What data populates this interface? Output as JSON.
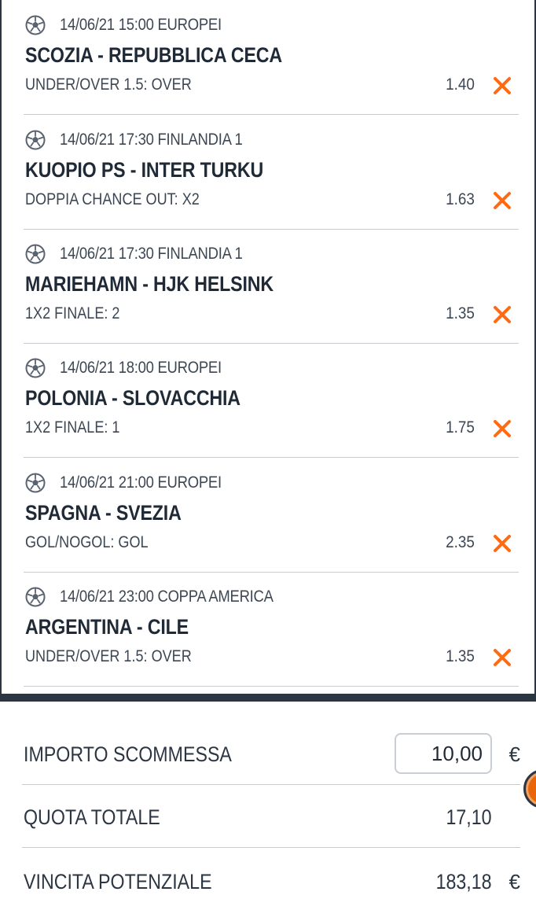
{
  "bets": [
    {
      "meta": "14/06/21 15:00 EUROPEI",
      "match": "SCOZIA - REPUBBLICA CECA",
      "market": "UNDER/OVER 1.5: OVER",
      "odds": "1.40"
    },
    {
      "meta": "14/06/21 17:30 FINLANDIA 1",
      "match": "KUOPIO PS - INTER TURKU",
      "market": "DOPPIA CHANCE OUT: X2",
      "odds": "1.63"
    },
    {
      "meta": "14/06/21 17:30 FINLANDIA 1",
      "match": "MARIEHAMN - HJK HELSINK",
      "market": "1X2 FINALE: 2",
      "odds": "1.35"
    },
    {
      "meta": "14/06/21 18:00 EUROPEI",
      "match": "POLONIA - SLOVACCHIA",
      "market": "1X2 FINALE: 1",
      "odds": "1.75"
    },
    {
      "meta": "14/06/21 21:00 EUROPEI",
      "match": "SPAGNA - SVEZIA",
      "market": "GOL/NOGOL: GOL",
      "odds": "2.35"
    },
    {
      "meta": "14/06/21 23:00 COPPA AMERICA",
      "match": "ARGENTINA - CILE",
      "market": "UNDER/OVER 1.5: OVER",
      "odds": "1.35"
    }
  ],
  "summary": {
    "stake_label": "IMPORTO SCOMMESSA",
    "stake_value": "10,00",
    "currency": "€",
    "total_odds_label": "QUOTA TOTALE",
    "total_odds_value": "17,10",
    "potential_win_label": "VINCITA POTENZIALE",
    "potential_win_value": "183,18"
  },
  "icons": {
    "sport": "soccer-ball-icon",
    "remove": "close-icon"
  },
  "colors": {
    "accent": "#ff6a13",
    "dark": "#2c3642",
    "border": "#c8ccd0"
  }
}
